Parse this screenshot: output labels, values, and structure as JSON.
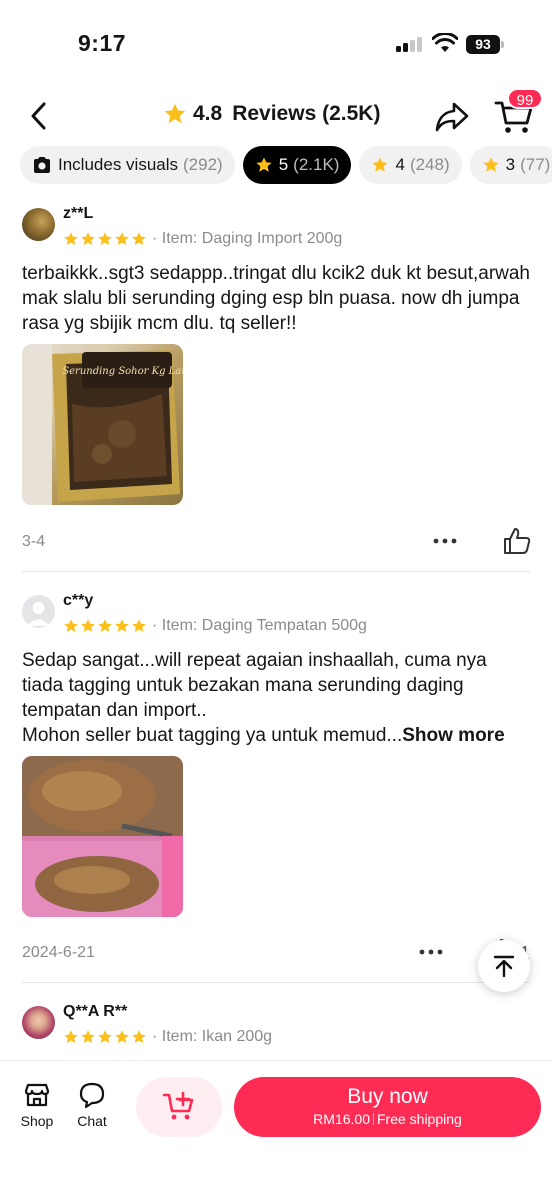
{
  "status_bar": {
    "time": "9:17",
    "battery": "93"
  },
  "header": {
    "rating": "4.8",
    "title": "Reviews (2.5K)",
    "cart_badge": "99"
  },
  "filters": [
    {
      "label": "Includes visuals",
      "count": "(292)",
      "icon": "camera-icon",
      "active": false
    },
    {
      "label": "5",
      "count": "(2.1K)",
      "icon": "star-icon",
      "active": true
    },
    {
      "label": "4",
      "count": "(248)",
      "icon": "star-icon",
      "active": false
    },
    {
      "label": "3",
      "count": "(77)",
      "icon": "star-icon",
      "active": false
    }
  ],
  "reviews": [
    {
      "username": "z**L",
      "stars": 5,
      "item": "Item: Daging Import 200g",
      "text": "terbaikkk..sgt3 sedappp..tringat dlu kcik2 duk kt besut,arwah mak slalu bli serunding dging esp bln puasa. now dh jumpa rasa yg sbijik mcm dlu. tq seller!!",
      "photo_caption": "Serunding Sohor Kg Laut",
      "date": "3-4",
      "likes": ""
    },
    {
      "username": "c**y",
      "stars": 5,
      "item": "Item: Daging Tempatan 500g",
      "text": "Sedap sangat...will repeat agaian inshaallah,  cuma nya tiada tagging untuk bezakan mana serunding daging tempatan dan import..\nMohon seller buat tagging ya untuk memud...",
      "show_more": "Show more",
      "date": "2024-6-21",
      "likes": "1"
    },
    {
      "username": "Q**A R**",
      "stars": 5,
      "item": "Item: Ikan 200g"
    }
  ],
  "bottom_bar": {
    "shop_label": "Shop",
    "chat_label": "Chat",
    "buy_label": "Buy now",
    "price": "RM16.00",
    "shipping": "Free shipping"
  },
  "colors": {
    "accent": "#fe2c55",
    "star": "#fbbf19",
    "muted": "#8a8b91"
  }
}
